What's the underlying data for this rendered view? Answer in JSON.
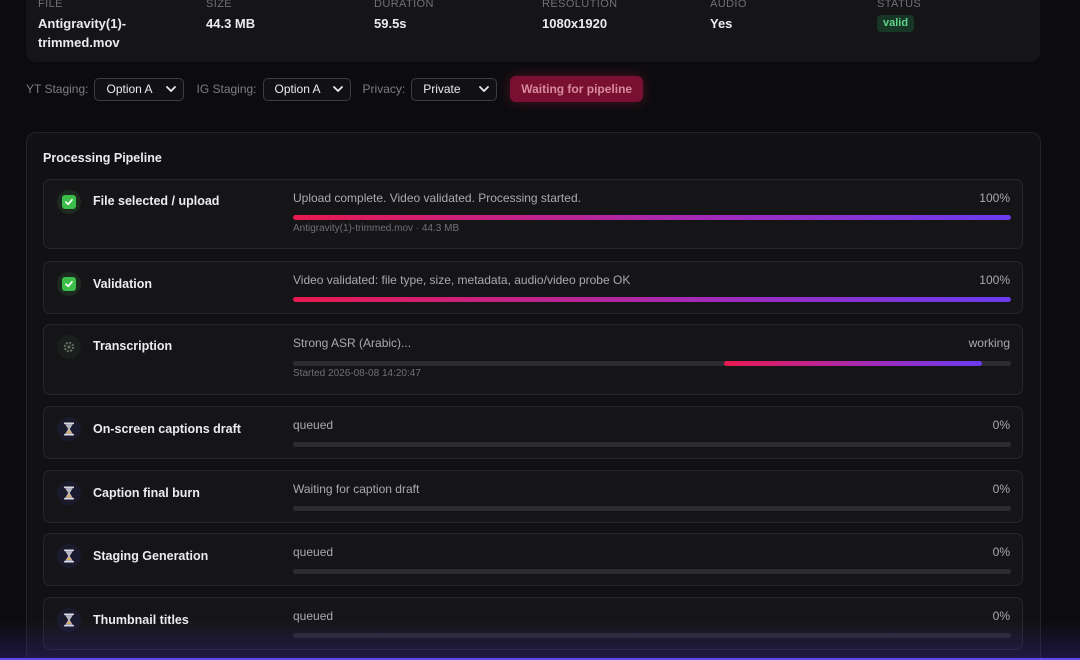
{
  "file_info": {
    "file_label": "FILE",
    "file_value_line1": "Antigravity(1)-",
    "file_value_line2": "trimmed.mov",
    "size_label": "SIZE",
    "size_value": "44.3 MB",
    "duration_label": "DURATION",
    "duration_value": "59.5s",
    "resolution_label": "RESOLUTION",
    "resolution_value": "1080x1920",
    "audio_label": "AUDIO",
    "audio_value": "Yes",
    "status_label": "STATUS",
    "status_value": "valid"
  },
  "controls": {
    "yt_label": "YT Staging:",
    "yt_value": "Option A",
    "ig_label": "IG Staging:",
    "ig_value": "Option A",
    "privacy_label": "Privacy:",
    "privacy_value": "Private",
    "action_label": "Waiting for pipeline"
  },
  "pipeline": {
    "title": "Processing Pipeline",
    "steps": [
      {
        "name": "File selected / upload",
        "icon": "check-icon",
        "message": "Upload complete. Video validated. Processing started.",
        "percent_label": "100%",
        "progress": 1.0,
        "sub": "Antigravity(1)-trimmed.mov · 44.3 MB"
      },
      {
        "name": "Validation",
        "icon": "check-icon",
        "message": "Video validated: file type, size, metadata, audio/video probe OK",
        "percent_label": "100%",
        "progress": 1.0
      },
      {
        "name": "Transcription",
        "icon": "gear-icon",
        "message": "Strong ASR (Arabic)...",
        "percent_label": "working",
        "progress_indeterminate_segment": [
          0.6,
          0.96
        ],
        "sub": "Started 2026-08-08 14:20:47"
      },
      {
        "name": "On-screen captions draft",
        "icon": "hourglass-icon",
        "message": "queued",
        "percent_label": "0%",
        "progress": 0
      },
      {
        "name": "Caption final burn",
        "icon": "hourglass-icon",
        "message": "Waiting for caption draft",
        "percent_label": "0%",
        "progress": 0
      },
      {
        "name": "Staging Generation",
        "icon": "hourglass-icon",
        "message": "queued",
        "percent_label": "0%",
        "progress": 0
      },
      {
        "name": "Thumbnail titles",
        "icon": "hourglass-icon",
        "message": "queued",
        "percent_label": "0%",
        "progress": 0
      }
    ]
  },
  "colors": {
    "accent_start": "#e8194f",
    "accent_end": "#6a3cf0",
    "success": "#3bbf4a",
    "valid_badge_text": "#5fd38a"
  }
}
